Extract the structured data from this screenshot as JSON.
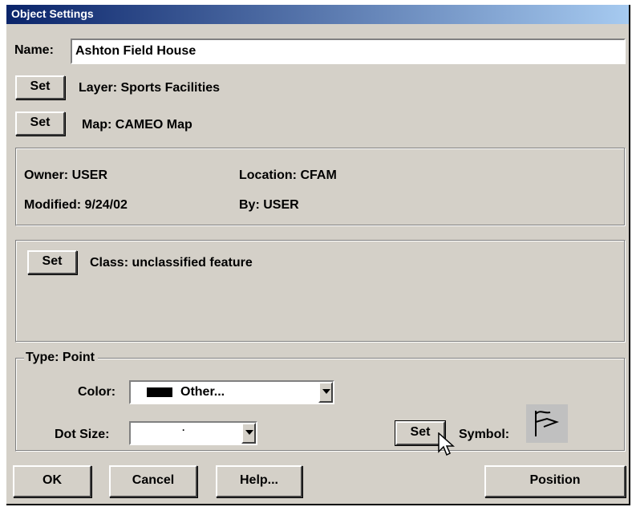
{
  "window": {
    "title": "Object Settings"
  },
  "name": {
    "label": "Name:",
    "value": "Ashton Field House"
  },
  "layer": {
    "button": "Set",
    "text": "Layer: Sports Facilities"
  },
  "map": {
    "button": "Set",
    "text": "Map: CAMEO Map"
  },
  "info": {
    "owner": "Owner: USER",
    "location": "Location: CFAM",
    "modified": "Modified: 9/24/02",
    "by": "By: USER"
  },
  "classification": {
    "button": "Set",
    "text": "Class:  unclassified feature"
  },
  "type": {
    "legend": "Type: Point",
    "color_label": "Color:",
    "color_value": "Other...",
    "color_swatch": "#000000",
    "dotsize_label": "Dot Size:",
    "dotsize_value": "·",
    "symbol_button": "Set",
    "symbol_label": "Symbol:",
    "symbol_icon": "flag-icon"
  },
  "footer": {
    "ok": "OK",
    "cancel": "Cancel",
    "help": "Help...",
    "position": "Position"
  }
}
